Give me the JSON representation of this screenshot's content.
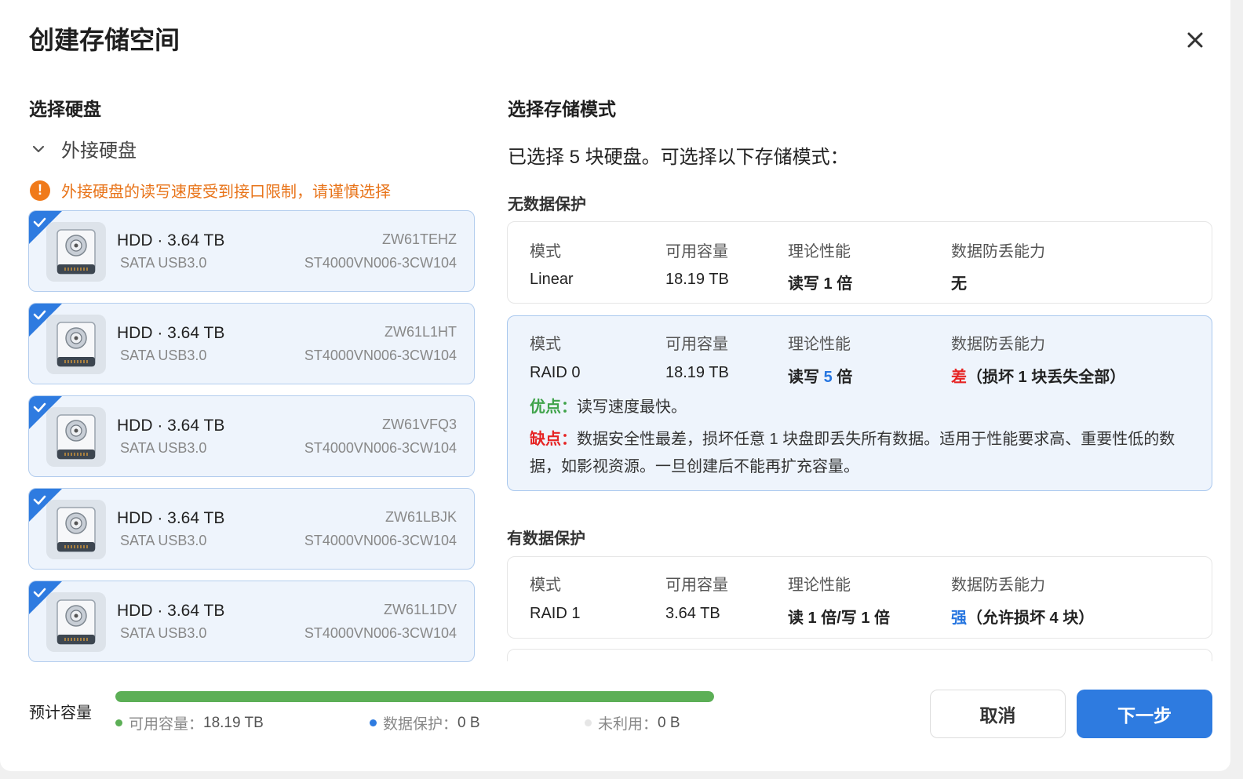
{
  "dialog": {
    "title": "创建存储空间",
    "close_icon": "close-icon"
  },
  "left": {
    "title": "选择硬盘",
    "group_label": "外接硬盘",
    "warning_text": "外接硬盘的读写速度受到接口限制，请谨慎选择",
    "disks": [
      {
        "name": "HDD · 3.64 TB",
        "iface": "SATA USB3.0",
        "serial": "ZW61TEHZ",
        "model": "ST4000VN006-3CW104",
        "selected": true
      },
      {
        "name": "HDD · 3.64 TB",
        "iface": "SATA USB3.0",
        "serial": "ZW61L1HT",
        "model": "ST4000VN006-3CW104",
        "selected": true
      },
      {
        "name": "HDD · 3.64 TB",
        "iface": "SATA USB3.0",
        "serial": "ZW61VFQ3",
        "model": "ST4000VN006-3CW104",
        "selected": true
      },
      {
        "name": "HDD · 3.64 TB",
        "iface": "SATA USB3.0",
        "serial": "ZW61LBJK",
        "model": "ST4000VN006-3CW104",
        "selected": true
      },
      {
        "name": "HDD · 3.64 TB",
        "iface": "SATA USB3.0",
        "serial": "ZW61L1DV",
        "model": "ST4000VN006-3CW104",
        "selected": true
      }
    ]
  },
  "right": {
    "title": "选择存储模式",
    "subtitle": "已选择 5 块硬盘。可选择以下存储模式：",
    "no_protection_label": "无数据保护",
    "protection_label": "有数据保护",
    "headers": {
      "mode": "模式",
      "capacity": "可用容量",
      "performance": "理论性能",
      "protection": "数据防丢能力"
    },
    "modes": {
      "linear": {
        "mode": "Linear",
        "capacity": "18.19 TB",
        "performance": "读写 1 倍",
        "protection": "无"
      },
      "raid0": {
        "mode": "RAID 0",
        "capacity": "18.19 TB",
        "perf_prefix": "读写 ",
        "perf_num": "5",
        "perf_suffix": " 倍",
        "prot_word": "差",
        "prot_note": "（损坏 1 块丢失全部）",
        "pro_label": "优点：",
        "pro_text": "读写速度最快。",
        "con_label": "缺点：",
        "con_text": "数据安全性最差，损坏任意 1 块盘即丢失所有数据。适用于性能要求高、重要性低的数据，如影视资源。一旦创建后不能再扩充容量。",
        "selected": true
      },
      "raid1": {
        "mode": "RAID 1",
        "capacity": "3.64 TB",
        "performance": "读 1 倍/写 1 倍",
        "prot_word": "强",
        "prot_note": "（允许损坏 4 块）"
      }
    }
  },
  "footer": {
    "label": "预计容量",
    "usage_fraction": 1.0,
    "legend": [
      {
        "label": "可用容量：",
        "value": "18.19 TB",
        "color": "#5caf56"
      },
      {
        "label": "数据保护：",
        "value": "0 B",
        "color": "#2e7be0"
      },
      {
        "label": "未利用：",
        "value": "0 B",
        "color": "#e6e6e6"
      }
    ],
    "cancel_label": "取消",
    "next_label": "下一步"
  },
  "colors": {
    "accent": "#2e7be0",
    "warning": "#f07a1a",
    "danger": "#e62424",
    "success": "#3fa34a"
  }
}
